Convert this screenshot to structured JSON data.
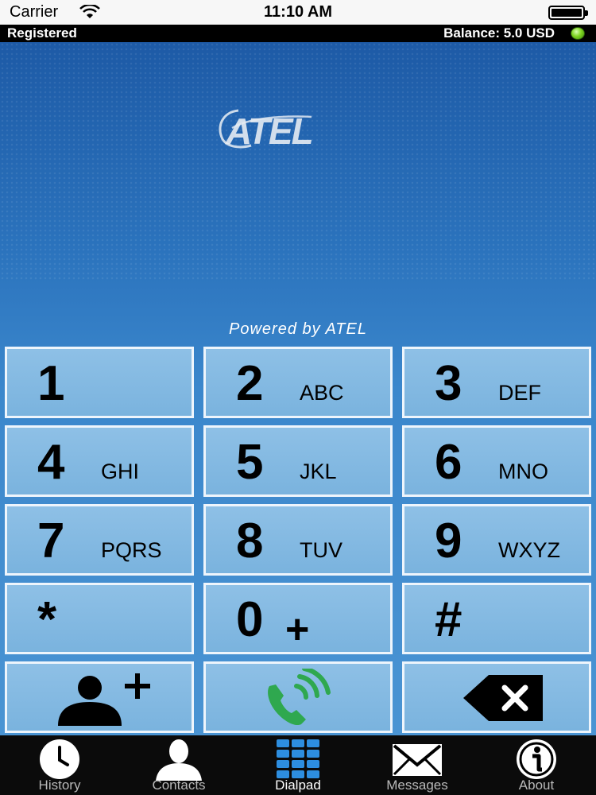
{
  "status_bar": {
    "carrier": "Carrier",
    "time": "11:10 AM"
  },
  "registration": {
    "status": "Registered",
    "balance": "Balance: 5.0 USD",
    "indicator_color": "#7ed321"
  },
  "branding": {
    "logo_text": "ATEL",
    "powered_by": "Powered by ATEL"
  },
  "keypad": {
    "keys": [
      {
        "num": "1",
        "letters": ""
      },
      {
        "num": "2",
        "letters": "ABC"
      },
      {
        "num": "3",
        "letters": "DEF"
      },
      {
        "num": "4",
        "letters": "GHI"
      },
      {
        "num": "5",
        "letters": "JKL"
      },
      {
        "num": "6",
        "letters": "MNO"
      },
      {
        "num": "7",
        "letters": "PQRS"
      },
      {
        "num": "8",
        "letters": "TUV"
      },
      {
        "num": "9",
        "letters": "WXYZ"
      },
      {
        "num": "*",
        "letters": ""
      },
      {
        "num": "0",
        "letters": "+"
      },
      {
        "num": "#",
        "letters": ""
      }
    ],
    "actions": {
      "add_contact_icon": "add-contact-icon",
      "call_icon": "call-icon",
      "backspace_icon": "backspace-icon",
      "call_color": "#2fa84f"
    }
  },
  "tabs": [
    {
      "label": "History",
      "icon": "clock-icon"
    },
    {
      "label": "Contacts",
      "icon": "person-icon"
    },
    {
      "label": "Dialpad",
      "icon": "dialpad-icon",
      "active": true
    },
    {
      "label": "Messages",
      "icon": "envelope-icon"
    },
    {
      "label": "About",
      "icon": "info-icon"
    }
  ],
  "colors": {
    "background_top": "#1d5aa6",
    "background_bottom": "#4a94d3",
    "key_fill": "#84bae2",
    "key_border": "#eef5fc",
    "tab_active": "#2d8ee0"
  }
}
